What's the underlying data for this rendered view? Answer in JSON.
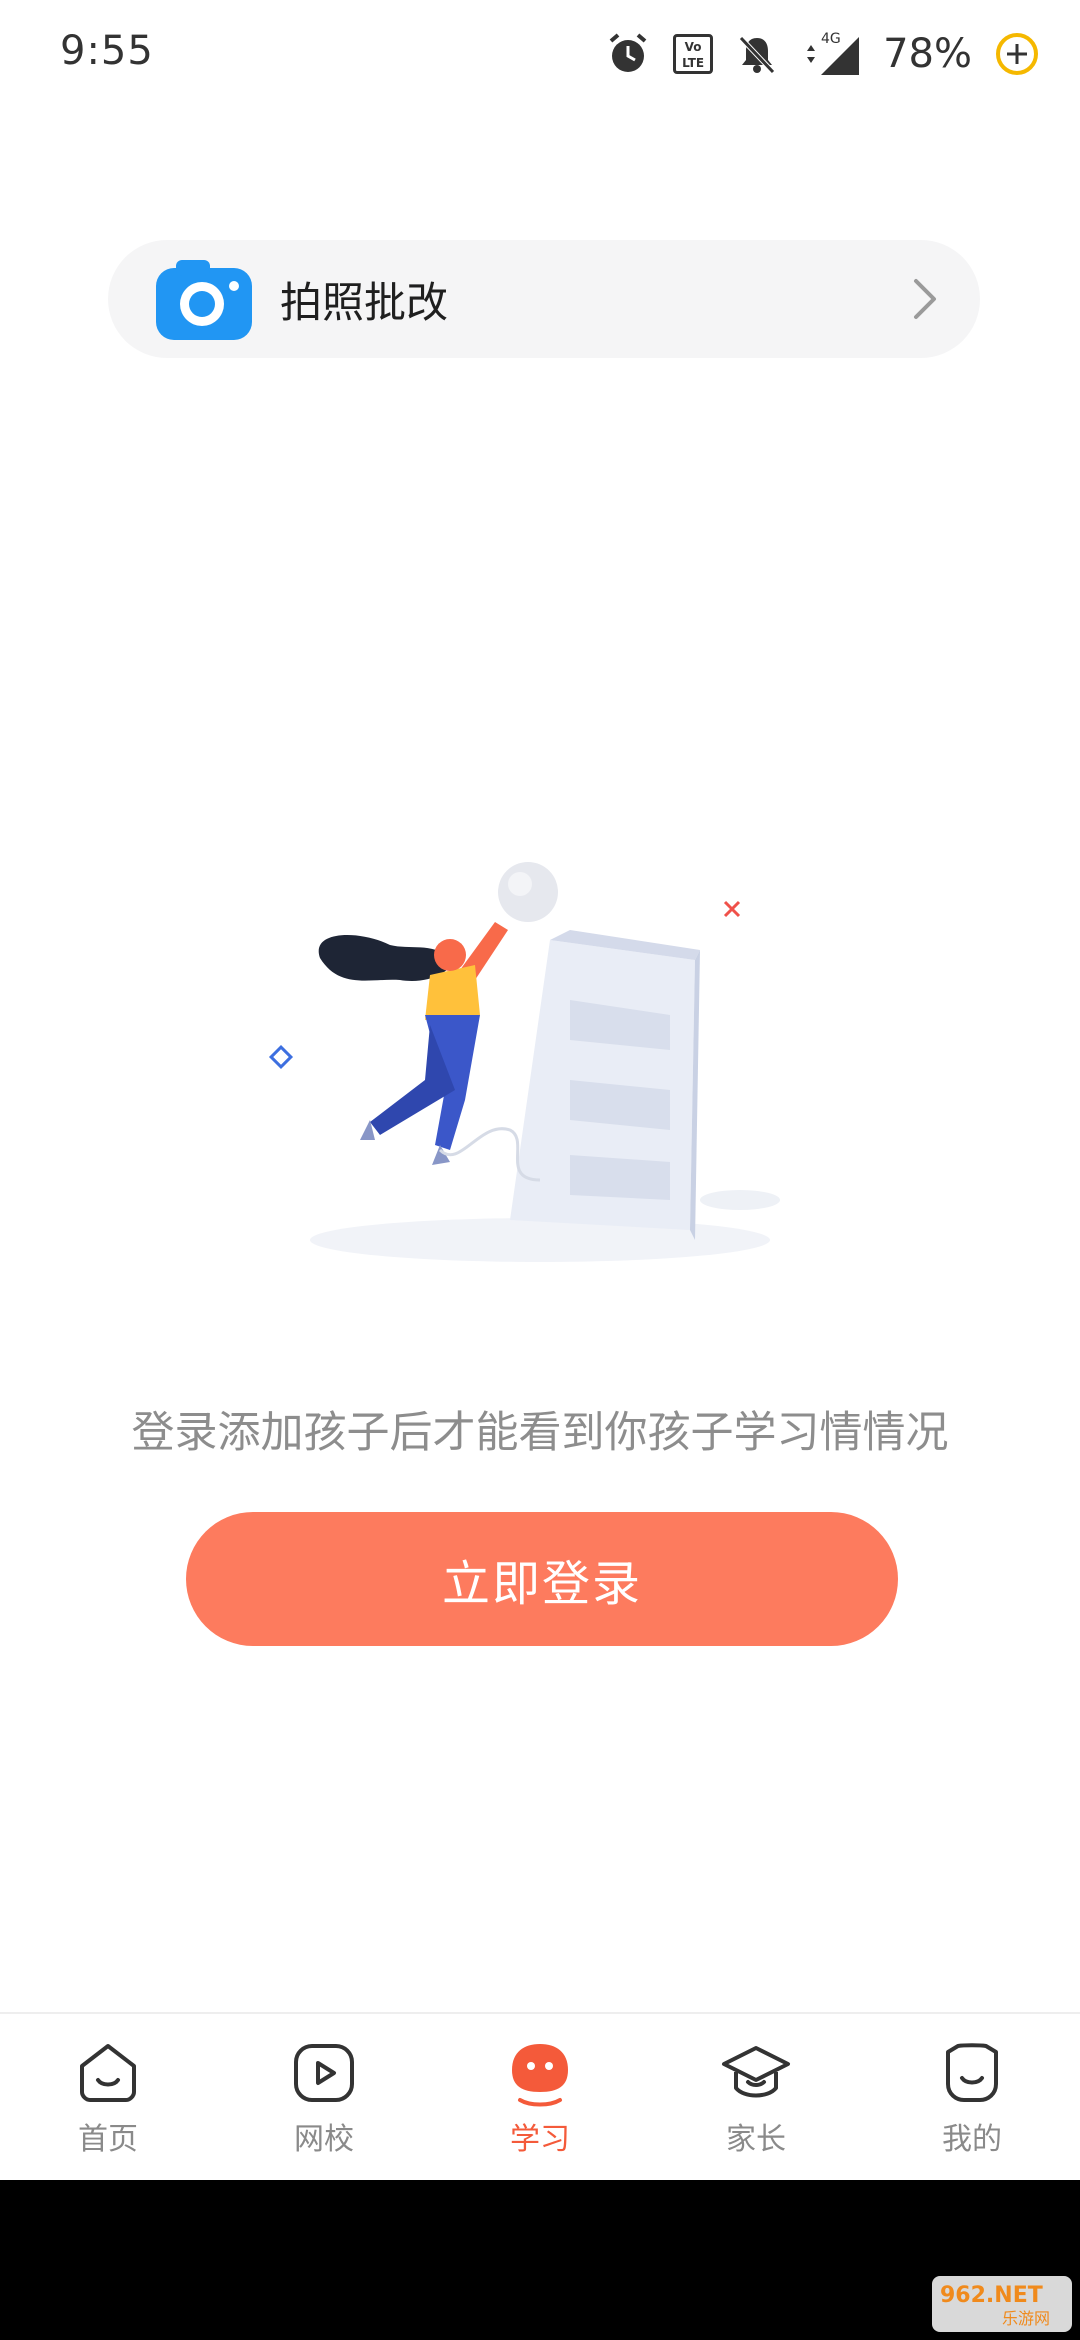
{
  "status_bar": {
    "time": "9:55",
    "battery": "78%",
    "network": "4G",
    "volte_top": "Vo",
    "volte_bottom": "LTE"
  },
  "photo_card": {
    "label": "拍照批改",
    "icon": "camera-icon"
  },
  "main": {
    "message": "登录添加孩子后才能看到你孩子学习情情况",
    "login_button": "立即登录"
  },
  "bottom_nav": {
    "items": [
      {
        "label": "首页",
        "icon": "home-face-icon"
      },
      {
        "label": "网校",
        "icon": "play-icon"
      },
      {
        "label": "学习",
        "icon": "study-face-icon",
        "active": true
      },
      {
        "label": "家长",
        "icon": "graduation-cap-icon"
      },
      {
        "label": "我的",
        "icon": "profile-face-icon"
      }
    ]
  },
  "watermark": {
    "text_top": "962.NET",
    "text_bottom": "乐游网"
  },
  "colors": {
    "accent": "#fd7b5e",
    "active_nav": "#f45a3a",
    "card_bg": "#f5f5f6",
    "camera_blue": "#2196f3"
  }
}
